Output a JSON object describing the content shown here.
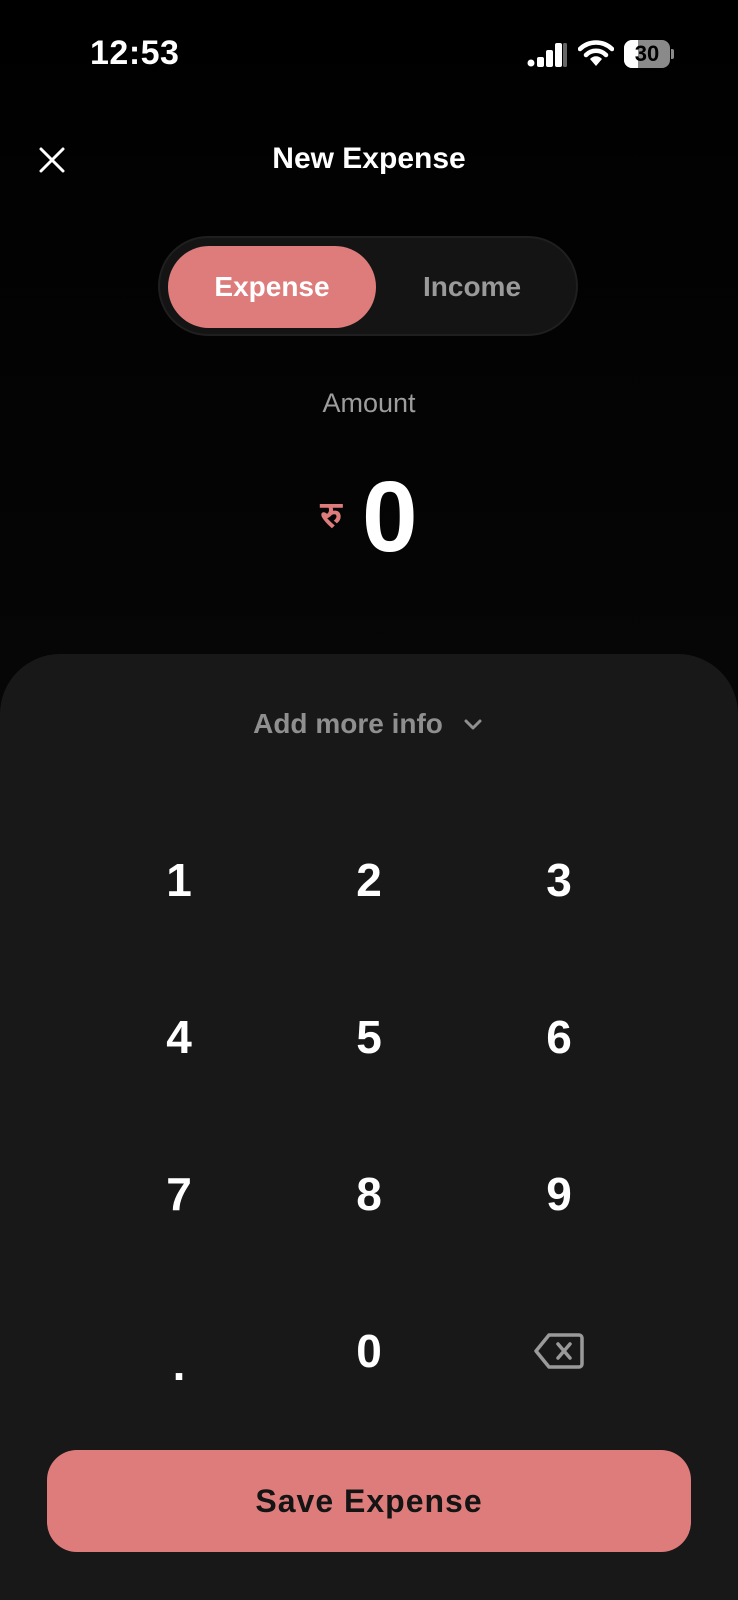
{
  "status_bar": {
    "time": "12:53",
    "battery_level": "30",
    "battery_fraction": 0.3,
    "icons": [
      "signal-icon",
      "wifi-icon",
      "battery-icon"
    ]
  },
  "header": {
    "title": "New Expense",
    "close_icon": "close-icon"
  },
  "type_toggle": {
    "options": [
      {
        "label": "Expense",
        "selected": true
      },
      {
        "label": "Income",
        "selected": false
      }
    ]
  },
  "amount": {
    "label": "Amount",
    "currency_symbol": "रु",
    "value": "0"
  },
  "more_info": {
    "label": "Add more info",
    "icon": "chevron-down-icon"
  },
  "keypad": {
    "keys": [
      "1",
      "2",
      "3",
      "4",
      "5",
      "6",
      "7",
      "8",
      "9",
      ".",
      "0"
    ],
    "backspace_icon": "backspace-icon"
  },
  "save_button": {
    "label": "Save Expense"
  },
  "colors": {
    "accent": "#de7c7c",
    "background": "#000000",
    "sheet": "#181818",
    "muted_text": "#9d9d9d"
  }
}
